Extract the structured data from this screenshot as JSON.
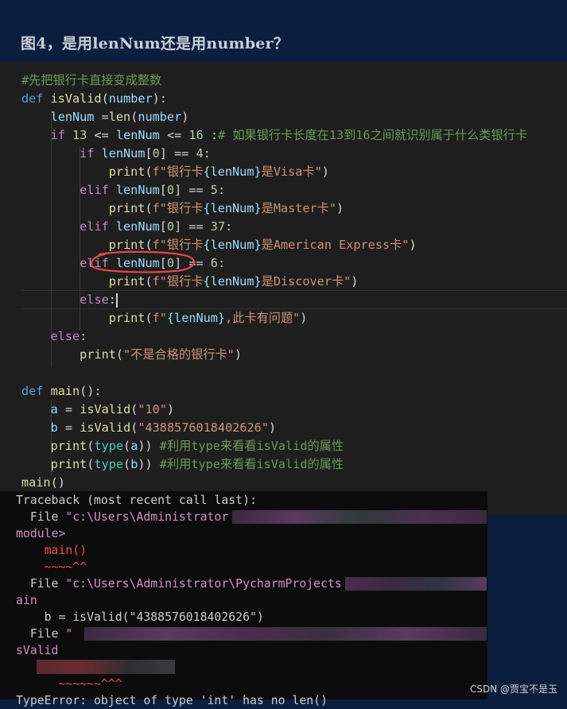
{
  "heading": "图4，是用lenNum还是用number？",
  "code": {
    "l1": "#先把银行卡直接变成整数",
    "l2_kw": "def",
    "l2_fn": "isValid",
    "l2_param": "number",
    "l3_var": "lenNum",
    "l3_fn": "len",
    "l3_arg": "number",
    "l4_num1": "13",
    "l4_var": "lenNum",
    "l4_num2": "16",
    "l4_comment": "# 如果银行卡长度在13到16之间就识别属于什么类银行卡",
    "l5_idx": "0",
    "l5_val": "4",
    "l6_str1": "f\"银行卡",
    "l6_var": "{lenNum}",
    "l6_str2": "是Visa卡\"",
    "l7_idx": "0",
    "l7_val": "5",
    "l8_str1": "f\"银行卡",
    "l8_var": "{lenNum}",
    "l8_str2": "是Master卡\"",
    "l9_idx": "0",
    "l9_val": "37",
    "l10_str1": "f\"银行卡",
    "l10_var": "{lenNum}",
    "l10_str2": "是American Express卡\"",
    "l11_idx": "0",
    "l11_val": "6",
    "l12_str1": "f\"银行卡",
    "l12_var": "{lenNum}",
    "l12_str2": "是Discover卡\"",
    "l14_str1": "f\"",
    "l14_var": "{lenNum}",
    "l14_str2": ",此卡有问题\"",
    "l16_str": "\"不是合格的银行卡\"",
    "l18_fn": "main",
    "l19_str": "\"10\"",
    "l20_str": "\"4388576018402626\"",
    "l21_comment": "#利用type来看看isValid的属性",
    "l22_comment": "#利用type来看看isValid的属性"
  },
  "terminal": {
    "t1": "Traceback (most recent call last):",
    "t2a": "  File ",
    "t2b": "\"c:\\Users\\Administrator",
    "t3": "module>",
    "t4": "    main()",
    "t5": "    ~~~~^^",
    "t6a": "  File ",
    "t6b": "\"c:\\Users\\Administrator\\PycharmProjects",
    "t7": "ain",
    "t8": "    b = isValid(\"4388576018402626\")",
    "t9a": "  File ",
    "t9b": "\"",
    "t10": "sValid",
    "t12": "      ~~~~~~^^^",
    "t13": "TypeError: object of type 'int' has no len()"
  },
  "watermark": "CSDN @贾宝不是玉"
}
